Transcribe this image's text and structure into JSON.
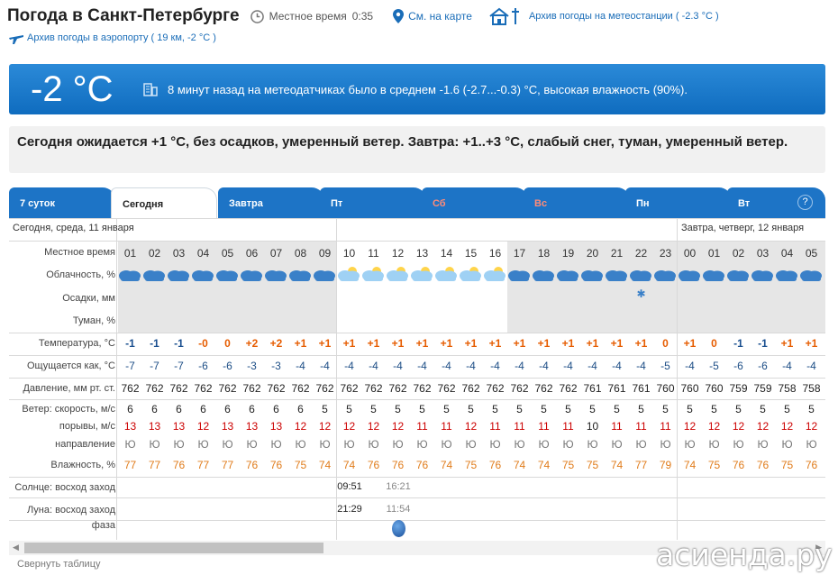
{
  "header": {
    "city": "Погода в Санкт-Петербурге",
    "local_time_label": "Местное время",
    "local_time": "0:35",
    "map_link": "См. на карте",
    "station_link": "Архив погоды на метеостанции ( -2.3 °C )",
    "airport_link": "Архив погоды в аэропорту ( 19 км, -2 °C )"
  },
  "current": {
    "temp": "-2 °C",
    "desc": "8 минут назад на метеодатчиках было в среднем -1.6 (-2.7...-0.3) °C, высокая влажность (90%)."
  },
  "forecast": "Сегодня ожидается +1 °C, без осадков, умеренный ветер. Завтра: +1..+3 °C, слабый снег, туман, умеренный ветер.",
  "tabs": [
    {
      "label": "7 суток"
    },
    {
      "label": "Сегодня"
    },
    {
      "label": "Завтра"
    },
    {
      "label": "Пт"
    },
    {
      "label": "Сб"
    },
    {
      "label": "Вс"
    },
    {
      "label": "Пн"
    },
    {
      "label": "Вт"
    }
  ],
  "help": "?",
  "days": {
    "today": "Сегодня, среда, 11 января",
    "tomorrow": "Завтра, четверг, 12 января"
  },
  "labels": {
    "time": "Местное время",
    "cloud": "Облачность, %",
    "precip": "Осадки, мм",
    "fog": "Туман, %",
    "temp": "Температура, °C",
    "feels": "Ощущается как, °C",
    "pressure": "Давление, мм рт. ст.",
    "wind": "Ветер: скорость, м/с",
    "gusts": "порывы, м/с",
    "dir": "направление",
    "humidity": "Влажность, %",
    "sun": "Солнце: восход заход",
    "moon": "Луна: восход заход",
    "phase": "фаза"
  },
  "hours": [
    "01",
    "02",
    "03",
    "04",
    "05",
    "06",
    "07",
    "08",
    "09",
    "10",
    "11",
    "12",
    "13",
    "14",
    "15",
    "16",
    "17",
    "18",
    "19",
    "20",
    "21",
    "22",
    "23",
    "00",
    "01",
    "02",
    "03",
    "04",
    "05"
  ],
  "temp": [
    "-1",
    "-1",
    "-1",
    "-0",
    "0",
    "+2",
    "+2",
    "+1",
    "+1",
    "+1",
    "+1",
    "+1",
    "+1",
    "+1",
    "+1",
    "+1",
    "+1",
    "+1",
    "+1",
    "+1",
    "+1",
    "+1",
    "0",
    "+1",
    "0",
    "-1",
    "-1",
    "+1",
    "+1"
  ],
  "feels": [
    "-7",
    "-7",
    "-7",
    "-6",
    "-6",
    "-3",
    "-3",
    "-4",
    "-4",
    "-4",
    "-4",
    "-4",
    "-4",
    "-4",
    "-4",
    "-4",
    "-4",
    "-4",
    "-4",
    "-4",
    "-4",
    "-4",
    "-5",
    "-4",
    "-5",
    "-6",
    "-6",
    "-4",
    "-4"
  ],
  "pressure": [
    "762",
    "762",
    "762",
    "762",
    "762",
    "762",
    "762",
    "762",
    "762",
    "762",
    "762",
    "762",
    "762",
    "762",
    "762",
    "762",
    "762",
    "762",
    "762",
    "761",
    "761",
    "761",
    "760",
    "760",
    "760",
    "759",
    "759",
    "758",
    "758"
  ],
  "wind": [
    "6",
    "6",
    "6",
    "6",
    "6",
    "6",
    "6",
    "6",
    "5",
    "5",
    "5",
    "5",
    "5",
    "5",
    "5",
    "5",
    "5",
    "5",
    "5",
    "5",
    "5",
    "5",
    "5",
    "5",
    "5",
    "5",
    "5",
    "5",
    "5"
  ],
  "gusts": [
    "13",
    "13",
    "13",
    "12",
    "13",
    "13",
    "13",
    "12",
    "12",
    "12",
    "12",
    "12",
    "11",
    "11",
    "12",
    "11",
    "11",
    "11",
    "11",
    "10",
    "11",
    "11",
    "11",
    "12",
    "12",
    "12",
    "12",
    "12",
    "12"
  ],
  "dir": [
    "Ю",
    "Ю",
    "Ю",
    "Ю",
    "Ю",
    "Ю",
    "Ю",
    "Ю",
    "Ю",
    "Ю",
    "Ю",
    "Ю",
    "Ю",
    "Ю",
    "Ю",
    "Ю",
    "Ю",
    "Ю",
    "Ю",
    "Ю",
    "Ю",
    "Ю",
    "Ю",
    "Ю",
    "Ю",
    "Ю",
    "Ю",
    "Ю",
    "Ю"
  ],
  "humidity": [
    "77",
    "77",
    "76",
    "77",
    "77",
    "76",
    "76",
    "75",
    "74",
    "74",
    "76",
    "76",
    "76",
    "74",
    "75",
    "76",
    "74",
    "74",
    "75",
    "75",
    "74",
    "77",
    "79",
    "74",
    "75",
    "76",
    "76",
    "75",
    "76"
  ],
  "sun": {
    "rise": "09:51",
    "set": "16:21"
  },
  "moon": {
    "rise": "21:29",
    "set": "11:54"
  },
  "snow_mark": "✱",
  "ui": {
    "collapse": "Свернуть таблицу",
    "left_arrow": "◀",
    "right_arrow": "▶"
  },
  "watermark": "асиенда.ру",
  "colors": {
    "accent": "#1d74c6",
    "positive": "#e65c00",
    "negative": "#1a4f8f",
    "gust": "#cc0000"
  }
}
